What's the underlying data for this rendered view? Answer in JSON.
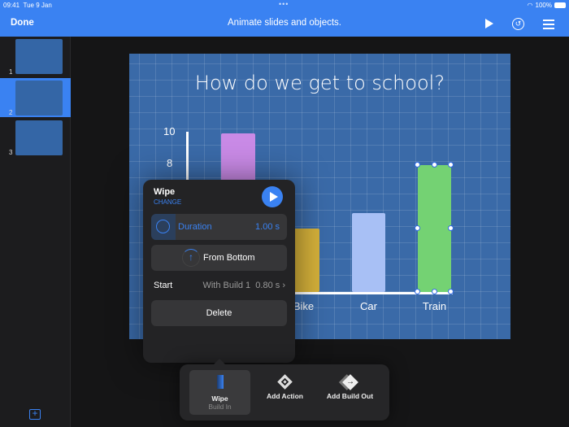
{
  "status": {
    "time": "09:41",
    "date": "Tue 9 Jan",
    "battery": "100%"
  },
  "toolbar": {
    "done": "Done",
    "title": "Animate slides and objects.",
    "icons": [
      "play-icon",
      "undo-icon",
      "list-icon"
    ]
  },
  "sidebar": {
    "slides": [
      {
        "number": "1"
      },
      {
        "number": "2",
        "selected": true
      },
      {
        "number": "3"
      }
    ]
  },
  "slide": {
    "title": "How do we get to school?",
    "y_ticks": [
      "10",
      "8"
    ],
    "bars": [
      {
        "label": "",
        "value": 10,
        "color": "#c98ae6"
      },
      {
        "label": "Bike",
        "value": 4,
        "color": "#d4b03a"
      },
      {
        "label": "Car",
        "value": 5,
        "color": "#a8c0f5"
      },
      {
        "label": "Train",
        "value": 8,
        "color": "#74d273",
        "selected": true
      }
    ]
  },
  "popover": {
    "title": "Wipe",
    "change": "CHANGE",
    "duration_label": "Duration",
    "duration_value": "1.00 s",
    "direction": "From Bottom",
    "start_label": "Start",
    "start_value": "With Build 1  0.80 s",
    "delete": "Delete"
  },
  "bottom": {
    "build_in_title": "Wipe",
    "build_in_sub": "Build In",
    "add_action": "Add Action",
    "add_build_out": "Add Build Out"
  },
  "colors": {
    "accent": "#3a82f2"
  }
}
